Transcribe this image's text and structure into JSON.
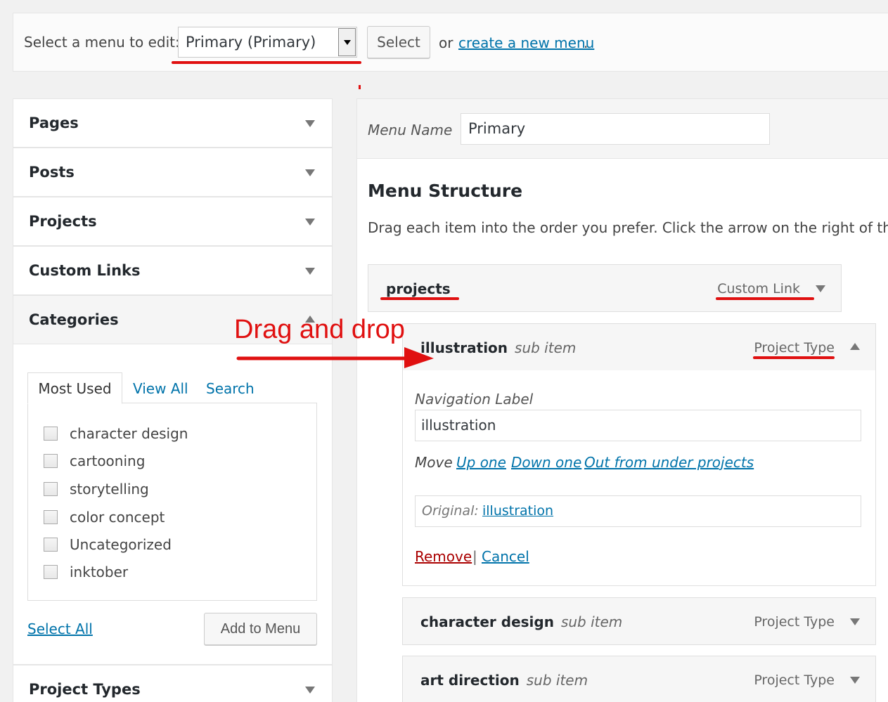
{
  "top_bar": {
    "label": "Select a menu to edit:",
    "selected_menu": "Primary (Primary)",
    "select_button": "Select",
    "or_text": "or",
    "create_link": "create a new menu",
    "create_suffix": "."
  },
  "left_panels": {
    "pages": "Pages",
    "posts": "Posts",
    "projects": "Projects",
    "custom_links": "Custom Links",
    "categories": "Categories",
    "project_types": "Project Types"
  },
  "categories": {
    "tabs": [
      "Most Used",
      "View All",
      "Search"
    ],
    "items": [
      "character design",
      "cartooning",
      "storytelling",
      "color concept",
      "Uncategorized",
      "inktober"
    ],
    "select_all": "Select All",
    "add_button": "Add to Menu"
  },
  "menu": {
    "name_label": "Menu Name",
    "name_value": "Primary",
    "structure_title": "Menu Structure",
    "structure_desc": "Drag each item into the order you prefer. Click the arrow on the right of the i"
  },
  "menu_items": [
    {
      "title": "projects",
      "sub": "",
      "type": "Custom Link"
    },
    {
      "title": "illustration",
      "sub": "sub item",
      "type": "Project Type"
    },
    {
      "title": "character design",
      "sub": "sub item",
      "type": "Project Type"
    },
    {
      "title": "art direction",
      "sub": "sub item",
      "type": "Project Type"
    }
  ],
  "item_settings": {
    "nav_label_title": "Navigation Label",
    "nav_label_value": "illustration",
    "move_label": "Move",
    "move_up": "Up one",
    "move_down": "Down one",
    "move_out": "Out from under projects",
    "original_label": "Original:",
    "original_link": "illustration",
    "remove": "Remove",
    "separator": "|",
    "cancel": "Cancel"
  },
  "annotation": {
    "text": "Drag and drop",
    "color": "#e01010"
  },
  "colors": {
    "link": "#0073aa",
    "remove": "#a00000",
    "annotation": "#e01010"
  }
}
